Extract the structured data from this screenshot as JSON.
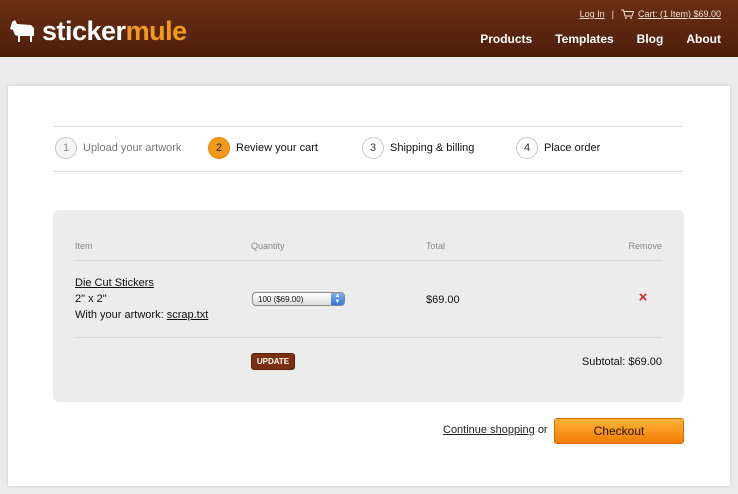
{
  "header": {
    "logo": {
      "part1": "sticker",
      "part2": "mule"
    },
    "util": {
      "login": "Log In",
      "separator": "|",
      "cart": "Cart: (1 Item) $69.00"
    },
    "nav": [
      "Products",
      "Templates",
      "Blog",
      "About"
    ]
  },
  "steps": [
    {
      "num": "1",
      "label": "Upload your artwork",
      "state": "done"
    },
    {
      "num": "2",
      "label": "Review your cart",
      "state": "active"
    },
    {
      "num": "3",
      "label": "Shipping & billing",
      "state": "todo"
    },
    {
      "num": "4",
      "label": "Place order",
      "state": "todo"
    }
  ],
  "cart": {
    "columns": {
      "item": "Item",
      "quantity": "Quantity",
      "total": "Total",
      "remove": "Remove"
    },
    "item": {
      "name": "Die Cut Stickers",
      "size": "2\" x 2\"",
      "artwork_prefix": "With your artwork:",
      "artwork_file": "scrap.txt",
      "quantity": "100 ($69.00)",
      "total": "$69.00",
      "remove_icon": "×"
    },
    "update_label": "UPDATE",
    "subtotal": "Subtotal: $69.00"
  },
  "actions": {
    "continue_link": "Continue shopping",
    "or": "or",
    "checkout": "Checkout"
  },
  "colors": {
    "header": "#5a2510",
    "accent": "#f39a1a",
    "remove": "#e02424"
  }
}
